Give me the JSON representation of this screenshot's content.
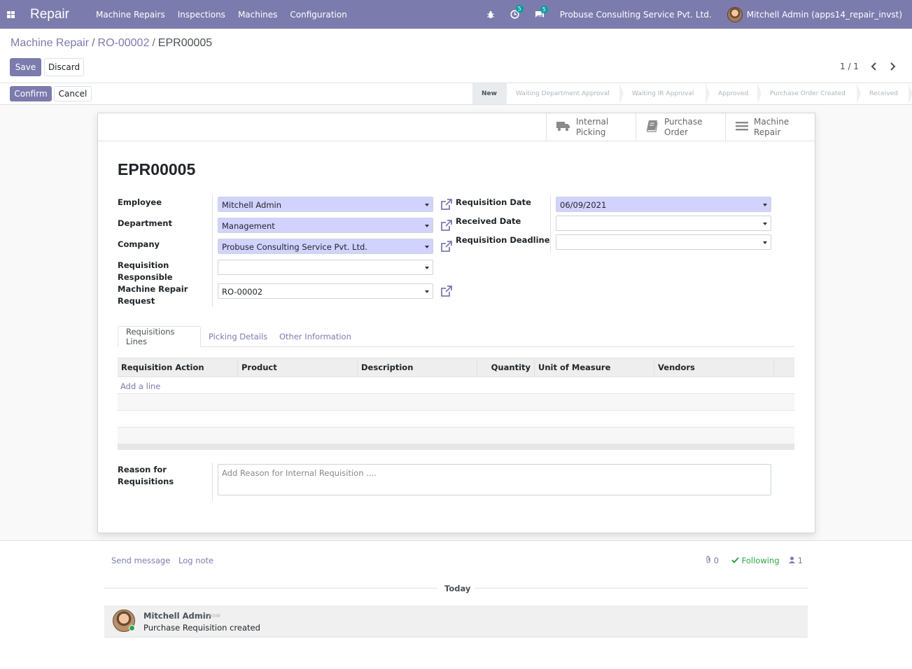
{
  "navbar": {
    "app_name": "Repair",
    "menu": [
      "Machine Repairs",
      "Inspections",
      "Machines",
      "Configuration"
    ],
    "activity_count": "5",
    "message_count": "5",
    "company": "Probuse Consulting Service Pvt. Ltd.",
    "user": "Mitchell Admin (apps14_repair_invst)"
  },
  "breadcrumb": {
    "items": [
      "Machine Repair",
      "RO-00002"
    ],
    "current": "EPR00005"
  },
  "toolbar": {
    "save": "Save",
    "discard": "Discard",
    "pager": "1 / 1"
  },
  "statusbar": {
    "confirm": "Confirm",
    "cancel": "Cancel",
    "stages": [
      "New",
      "Waiting Department Approval",
      "Waiting IR Approval",
      "Approved",
      "Purchase Order Created",
      "Received"
    ],
    "active_stage": "New"
  },
  "smart_buttons": [
    {
      "line1": "Internal",
      "line2": "Picking",
      "icon": "truck-icon"
    },
    {
      "line1": "Purchase",
      "line2": "Order",
      "icon": "book-icon"
    },
    {
      "line1": "Machine",
      "line2": "Repair",
      "icon": "bars-icon"
    }
  ],
  "form": {
    "title": "EPR00005",
    "employee_label": "Employee",
    "employee": "Mitchell Admin",
    "department_label": "Department",
    "department": "Management",
    "company_label": "Company",
    "company": "Probuse Consulting Service Pvt. Ltd.",
    "responsible_label1": "Requisition",
    "responsible_label2": "Responsible",
    "responsible": "",
    "repair_label1": "Machine Repair",
    "repair_label2": "Request",
    "repair_request": "RO-00002",
    "req_date_label": "Requisition Date",
    "req_date": "06/09/2021",
    "received_label": "Received Date",
    "received": "",
    "deadline_label": "Requisition Deadline",
    "deadline": ""
  },
  "tabs": [
    "Requisitions Lines",
    "Picking Details",
    "Other Information"
  ],
  "table": {
    "columns": [
      "Requisition Action",
      "Product",
      "Description",
      "Quantity",
      "Unit of Measure",
      "Vendors"
    ],
    "add_line": "Add a line"
  },
  "reason": {
    "label1": "Reason for",
    "label2": "Requisitions",
    "placeholder": "Add Reason for Internal Requisition ...."
  },
  "chatter": {
    "send_message": "Send message",
    "log_note": "Log note",
    "attachments": "0",
    "following": "Following",
    "followers": "1",
    "today": "Today",
    "author": "Mitchell Admin",
    "date": "- now",
    "body": "Purchase Requisition created"
  },
  "colors": {
    "brand": "#7c7bad",
    "required_field": "#d2d2ff",
    "following": "#28a745"
  }
}
